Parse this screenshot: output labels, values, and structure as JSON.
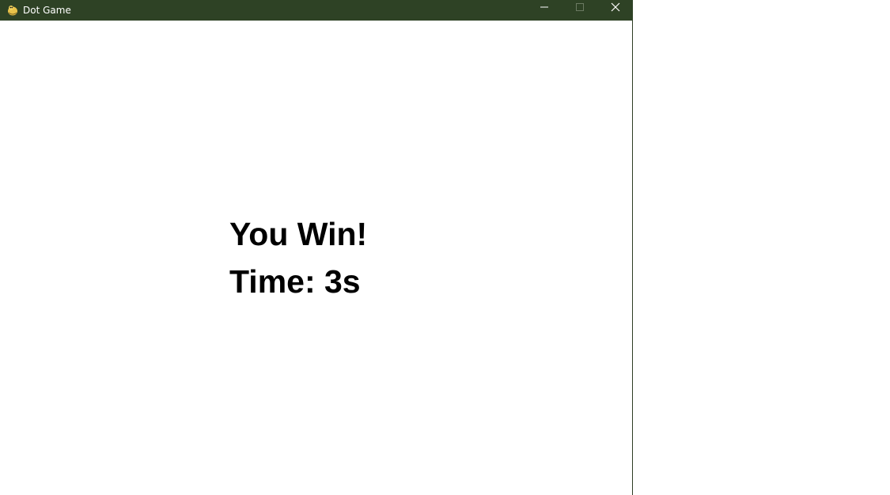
{
  "window": {
    "title": "Dot Game",
    "titlebar_color": "#2e4225",
    "icons": {
      "app": "pygame-snake-icon",
      "minimize": "minimize-icon",
      "maximize": "maximize-icon",
      "close": "close-icon"
    }
  },
  "game": {
    "result_text": "You Win!",
    "time_label": "Time: ",
    "time_value": "3s"
  }
}
